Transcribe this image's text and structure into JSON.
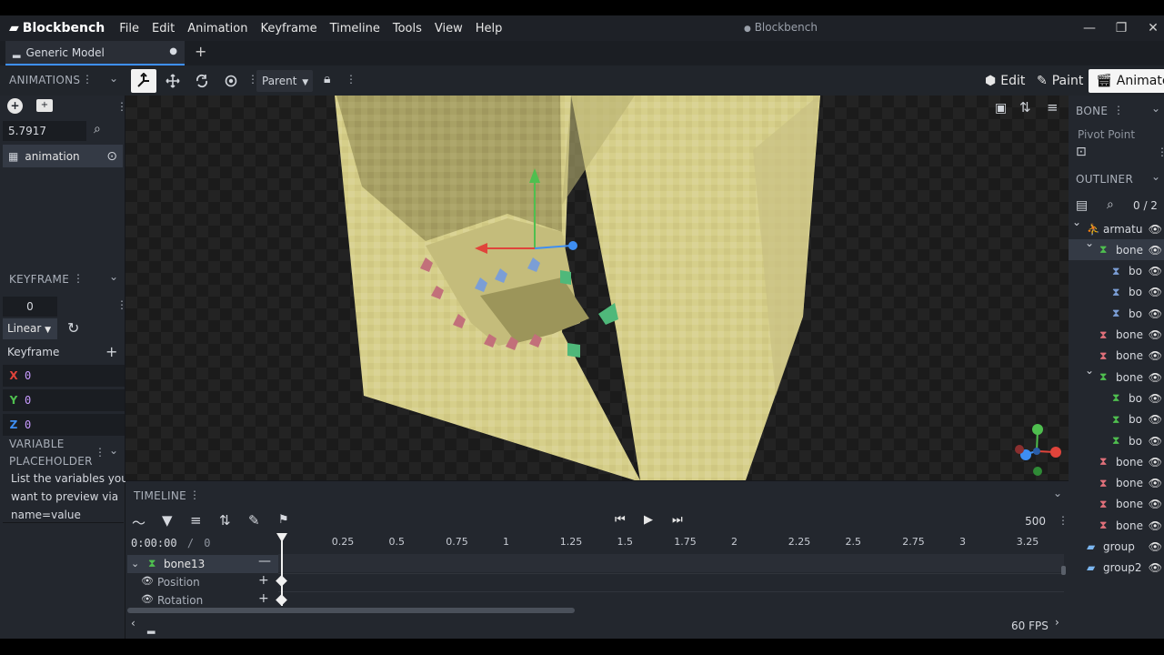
{
  "app": {
    "name": "Blockbench",
    "window_title": "Blockbench",
    "modified_dot": "●"
  },
  "menu": [
    "File",
    "Edit",
    "Animation",
    "Keyframe",
    "Timeline",
    "Tools",
    "View",
    "Help"
  ],
  "tabs": [
    {
      "label": "Generic Model",
      "close": "●"
    }
  ],
  "tab_add": "+",
  "window_controls": {
    "minimize": "—",
    "restore": "❐",
    "close": "✕"
  },
  "toolbar": {
    "parent_select": "Parent"
  },
  "modes": {
    "edit": "Edit",
    "paint": "Paint",
    "animate": "Animate"
  },
  "animations_panel": {
    "title": "ANIMATIONS",
    "length_value": "5.7917",
    "items": [
      {
        "label": "animation"
      }
    ]
  },
  "keyframe_panel": {
    "title": "KEYFRAME",
    "time_value": "0",
    "interpolation": "Linear",
    "section_label": "Keyframe",
    "axes": [
      {
        "axis": "X",
        "value": "0",
        "color": "#e0443b"
      },
      {
        "axis": "Y",
        "value": "0",
        "color": "#4fbf4f"
      },
      {
        "axis": "Z",
        "value": "0",
        "color": "#3e8ef2"
      }
    ]
  },
  "variable_panel": {
    "title_line1": "VARIABLE",
    "title_line2": "PLACEHOLDERS",
    "description": [
      "List the variables you",
      "want to preview via",
      "name=value"
    ]
  },
  "bone_panel": {
    "title": "BONE",
    "pivot_label": "Pivot Point"
  },
  "outliner": {
    "title": "OUTLINER",
    "count": "0 / 2",
    "rows": [
      {
        "label": "armatu",
        "indent": 0,
        "type": "armature",
        "expanded": true
      },
      {
        "label": "bone",
        "indent": 1,
        "type": "bone-green",
        "expanded": true,
        "selected": true
      },
      {
        "label": "bo",
        "indent": 2,
        "type": "bone-blue"
      },
      {
        "label": "bo",
        "indent": 2,
        "type": "bone-blue"
      },
      {
        "label": "bo",
        "indent": 2,
        "type": "bone-blue"
      },
      {
        "label": "bone",
        "indent": 1,
        "type": "bone-red"
      },
      {
        "label": "bone",
        "indent": 1,
        "type": "bone-red"
      },
      {
        "label": "bone",
        "indent": 1,
        "type": "bone-green",
        "expanded": true
      },
      {
        "label": "bo",
        "indent": 2,
        "type": "bone-green"
      },
      {
        "label": "bo",
        "indent": 2,
        "type": "bone-green"
      },
      {
        "label": "bo",
        "indent": 2,
        "type": "bone-green"
      },
      {
        "label": "bone",
        "indent": 1,
        "type": "bone-red"
      },
      {
        "label": "bone",
        "indent": 1,
        "type": "bone-red"
      },
      {
        "label": "bone",
        "indent": 1,
        "type": "bone-red"
      },
      {
        "label": "bone",
        "indent": 1,
        "type": "bone-red"
      },
      {
        "label": "group",
        "indent": 0,
        "type": "folder"
      },
      {
        "label": "group2",
        "indent": 0,
        "type": "folder"
      }
    ]
  },
  "timeline": {
    "title": "TIMELINE",
    "time_display": "0:00:00",
    "time_sep": "/",
    "time_total": "0",
    "zoom_value": "500",
    "fps_label": "60 FPS",
    "ticks": [
      "0.25",
      "0.5",
      "0.75",
      "1",
      "1.25",
      "1.5",
      "1.75",
      "2",
      "2.25",
      "2.5",
      "2.75",
      "3",
      "3.25"
    ],
    "bone_row": "bone13",
    "channels": [
      "Position",
      "Rotation"
    ]
  },
  "colors": {
    "accent": "#3e90ff",
    "model_face": "#d9d38e",
    "axis_x": "#e0443b",
    "axis_y": "#4fbf4f",
    "axis_z": "#3e8ef2"
  }
}
